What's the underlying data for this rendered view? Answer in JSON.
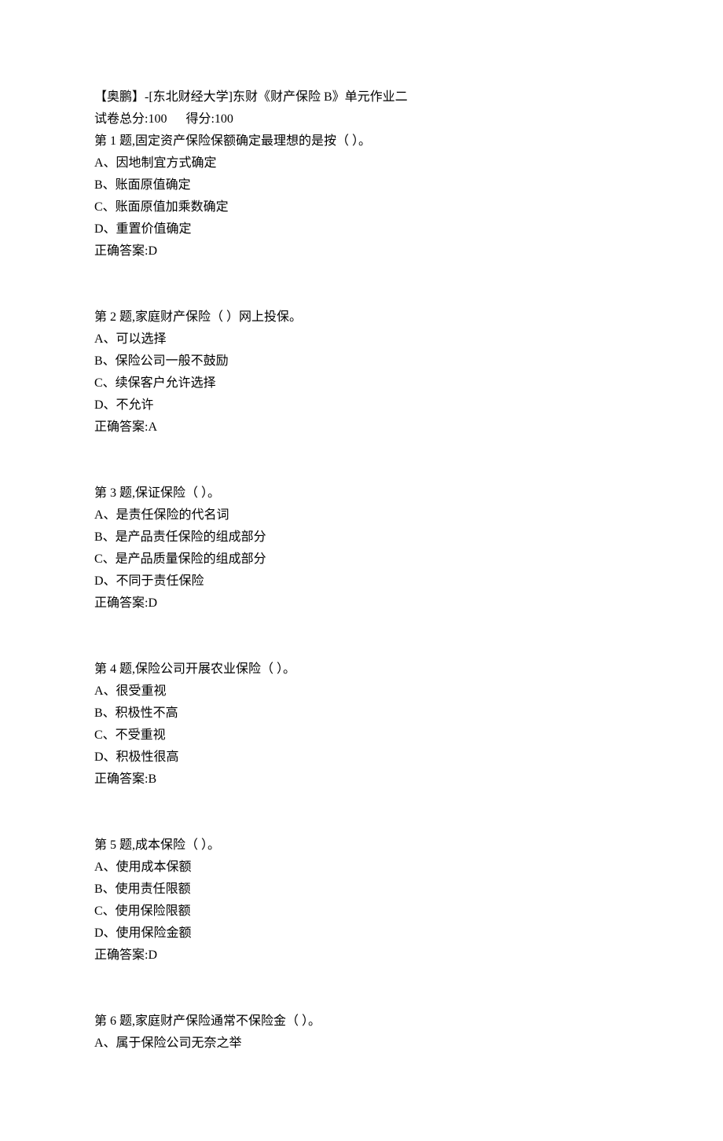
{
  "header": {
    "title": "【奥鹏】-[东北财经大学]东财《财产保险 B》单元作业二",
    "score_line": "试卷总分:100      得分:100"
  },
  "questions": [
    {
      "prompt": "第 1 题,固定资产保险保额确定最理想的是按（ ）。",
      "options": [
        "A、因地制宜方式确定",
        "B、账面原值确定",
        "C、账面原值加乘数确定",
        "D、重置价值确定"
      ],
      "answer": "正确答案:D"
    },
    {
      "prompt": "第 2 题,家庭财产保险（ ）网上投保。",
      "options": [
        "A、可以选择",
        "B、保险公司一般不鼓励",
        "C、续保客户允许选择",
        "D、不允许"
      ],
      "answer": "正确答案:A"
    },
    {
      "prompt": "第 3 题,保证保险（ ）。",
      "options": [
        "A、是责任保险的代名词",
        "B、是产品责任保险的组成部分",
        "C、是产品质量保险的组成部分",
        "D、不同于责任保险"
      ],
      "answer": "正确答案:D"
    },
    {
      "prompt": "第 4 题,保险公司开展农业保险（ ）。",
      "options": [
        "A、很受重视",
        "B、积极性不高",
        "C、不受重视",
        "D、积极性很高"
      ],
      "answer": "正确答案:B"
    },
    {
      "prompt": "第 5 题,成本保险（ ）。",
      "options": [
        "A、使用成本保额",
        "B、使用责任限额",
        "C、使用保险限额",
        "D、使用保险金额"
      ],
      "answer": "正确答案:D"
    },
    {
      "prompt": "第 6 题,家庭财产保险通常不保险金（ ）。",
      "options": [
        "A、属于保险公司无奈之举"
      ],
      "answer": ""
    }
  ]
}
